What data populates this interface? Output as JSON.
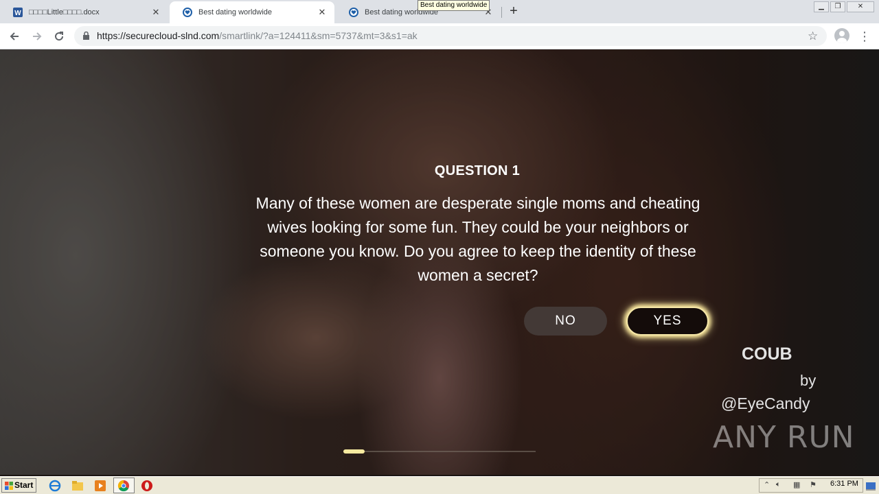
{
  "browser": {
    "tabs": [
      {
        "title": "□□□□Little□□□□.docx",
        "active": false,
        "icon": "word-icon"
      },
      {
        "title": "Best dating worldwide",
        "active": true,
        "icon": "heart-shield-icon"
      },
      {
        "title": "Best dating worldwide",
        "active": false,
        "icon": "heart-shield-icon"
      }
    ],
    "tooltip": "Best dating worldwide",
    "url_host": "https://securecloud-slnd.com",
    "url_rest": "/smartlink/?a=124411&sm=5737&mt=3&s1=ak",
    "window_controls": [
      "minimize",
      "restore",
      "close"
    ]
  },
  "content": {
    "question_title": "QUESTION 1",
    "question_text": "Many of these women are desperate single moms and cheating wives looking for some fun. They could be your neighbors or someone you know. Do you agree to keep the identity of these women a secret?",
    "no_label": "NO",
    "yes_label": "YES",
    "credit_brand": "COUB",
    "credit_by": "by",
    "credit_handle": "@EyeCandy",
    "watermark": "ANY RUN",
    "progress": 0.11,
    "colors": {
      "yes_glow": "#f5e39a",
      "progress": "#f7eaa0"
    }
  },
  "taskbar": {
    "start_label": "Start",
    "apps": [
      "ie-icon",
      "folder-icon",
      "media-player-icon",
      "chrome-icon",
      "opera-icon"
    ],
    "clock": "6:31 PM"
  }
}
